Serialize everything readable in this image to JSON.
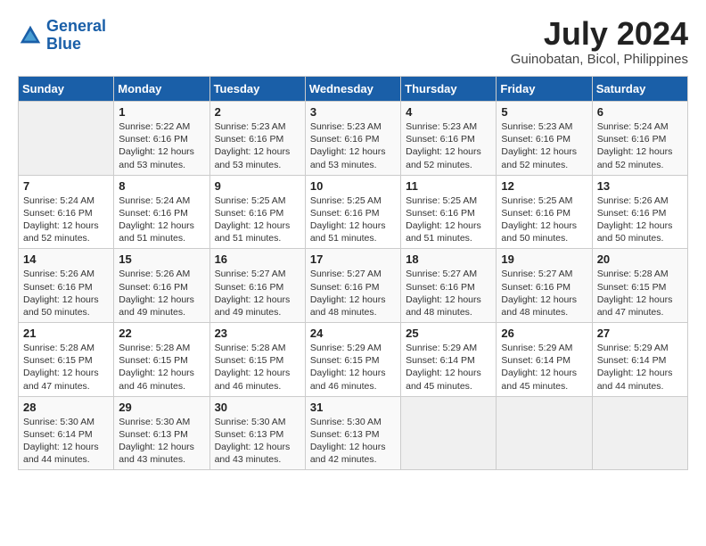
{
  "header": {
    "logo_line1": "General",
    "logo_line2": "Blue",
    "month_year": "July 2024",
    "location": "Guinobatan, Bicol, Philippines"
  },
  "days_of_week": [
    "Sunday",
    "Monday",
    "Tuesday",
    "Wednesday",
    "Thursday",
    "Friday",
    "Saturday"
  ],
  "weeks": [
    [
      {
        "day": "",
        "sunrise": "",
        "sunset": "",
        "daylight": ""
      },
      {
        "day": "1",
        "sunrise": "Sunrise: 5:22 AM",
        "sunset": "Sunset: 6:16 PM",
        "daylight": "Daylight: 12 hours and 53 minutes."
      },
      {
        "day": "2",
        "sunrise": "Sunrise: 5:23 AM",
        "sunset": "Sunset: 6:16 PM",
        "daylight": "Daylight: 12 hours and 53 minutes."
      },
      {
        "day": "3",
        "sunrise": "Sunrise: 5:23 AM",
        "sunset": "Sunset: 6:16 PM",
        "daylight": "Daylight: 12 hours and 53 minutes."
      },
      {
        "day": "4",
        "sunrise": "Sunrise: 5:23 AM",
        "sunset": "Sunset: 6:16 PM",
        "daylight": "Daylight: 12 hours and 52 minutes."
      },
      {
        "day": "5",
        "sunrise": "Sunrise: 5:23 AM",
        "sunset": "Sunset: 6:16 PM",
        "daylight": "Daylight: 12 hours and 52 minutes."
      },
      {
        "day": "6",
        "sunrise": "Sunrise: 5:24 AM",
        "sunset": "Sunset: 6:16 PM",
        "daylight": "Daylight: 12 hours and 52 minutes."
      }
    ],
    [
      {
        "day": "7",
        "sunrise": "Sunrise: 5:24 AM",
        "sunset": "Sunset: 6:16 PM",
        "daylight": "Daylight: 12 hours and 52 minutes."
      },
      {
        "day": "8",
        "sunrise": "Sunrise: 5:24 AM",
        "sunset": "Sunset: 6:16 PM",
        "daylight": "Daylight: 12 hours and 51 minutes."
      },
      {
        "day": "9",
        "sunrise": "Sunrise: 5:25 AM",
        "sunset": "Sunset: 6:16 PM",
        "daylight": "Daylight: 12 hours and 51 minutes."
      },
      {
        "day": "10",
        "sunrise": "Sunrise: 5:25 AM",
        "sunset": "Sunset: 6:16 PM",
        "daylight": "Daylight: 12 hours and 51 minutes."
      },
      {
        "day": "11",
        "sunrise": "Sunrise: 5:25 AM",
        "sunset": "Sunset: 6:16 PM",
        "daylight": "Daylight: 12 hours and 51 minutes."
      },
      {
        "day": "12",
        "sunrise": "Sunrise: 5:25 AM",
        "sunset": "Sunset: 6:16 PM",
        "daylight": "Daylight: 12 hours and 50 minutes."
      },
      {
        "day": "13",
        "sunrise": "Sunrise: 5:26 AM",
        "sunset": "Sunset: 6:16 PM",
        "daylight": "Daylight: 12 hours and 50 minutes."
      }
    ],
    [
      {
        "day": "14",
        "sunrise": "Sunrise: 5:26 AM",
        "sunset": "Sunset: 6:16 PM",
        "daylight": "Daylight: 12 hours and 50 minutes."
      },
      {
        "day": "15",
        "sunrise": "Sunrise: 5:26 AM",
        "sunset": "Sunset: 6:16 PM",
        "daylight": "Daylight: 12 hours and 49 minutes."
      },
      {
        "day": "16",
        "sunrise": "Sunrise: 5:27 AM",
        "sunset": "Sunset: 6:16 PM",
        "daylight": "Daylight: 12 hours and 49 minutes."
      },
      {
        "day": "17",
        "sunrise": "Sunrise: 5:27 AM",
        "sunset": "Sunset: 6:16 PM",
        "daylight": "Daylight: 12 hours and 48 minutes."
      },
      {
        "day": "18",
        "sunrise": "Sunrise: 5:27 AM",
        "sunset": "Sunset: 6:16 PM",
        "daylight": "Daylight: 12 hours and 48 minutes."
      },
      {
        "day": "19",
        "sunrise": "Sunrise: 5:27 AM",
        "sunset": "Sunset: 6:16 PM",
        "daylight": "Daylight: 12 hours and 48 minutes."
      },
      {
        "day": "20",
        "sunrise": "Sunrise: 5:28 AM",
        "sunset": "Sunset: 6:15 PM",
        "daylight": "Daylight: 12 hours and 47 minutes."
      }
    ],
    [
      {
        "day": "21",
        "sunrise": "Sunrise: 5:28 AM",
        "sunset": "Sunset: 6:15 PM",
        "daylight": "Daylight: 12 hours and 47 minutes."
      },
      {
        "day": "22",
        "sunrise": "Sunrise: 5:28 AM",
        "sunset": "Sunset: 6:15 PM",
        "daylight": "Daylight: 12 hours and 46 minutes."
      },
      {
        "day": "23",
        "sunrise": "Sunrise: 5:28 AM",
        "sunset": "Sunset: 6:15 PM",
        "daylight": "Daylight: 12 hours and 46 minutes."
      },
      {
        "day": "24",
        "sunrise": "Sunrise: 5:29 AM",
        "sunset": "Sunset: 6:15 PM",
        "daylight": "Daylight: 12 hours and 46 minutes."
      },
      {
        "day": "25",
        "sunrise": "Sunrise: 5:29 AM",
        "sunset": "Sunset: 6:14 PM",
        "daylight": "Daylight: 12 hours and 45 minutes."
      },
      {
        "day": "26",
        "sunrise": "Sunrise: 5:29 AM",
        "sunset": "Sunset: 6:14 PM",
        "daylight": "Daylight: 12 hours and 45 minutes."
      },
      {
        "day": "27",
        "sunrise": "Sunrise: 5:29 AM",
        "sunset": "Sunset: 6:14 PM",
        "daylight": "Daylight: 12 hours and 44 minutes."
      }
    ],
    [
      {
        "day": "28",
        "sunrise": "Sunrise: 5:30 AM",
        "sunset": "Sunset: 6:14 PM",
        "daylight": "Daylight: 12 hours and 44 minutes."
      },
      {
        "day": "29",
        "sunrise": "Sunrise: 5:30 AM",
        "sunset": "Sunset: 6:13 PM",
        "daylight": "Daylight: 12 hours and 43 minutes."
      },
      {
        "day": "30",
        "sunrise": "Sunrise: 5:30 AM",
        "sunset": "Sunset: 6:13 PM",
        "daylight": "Daylight: 12 hours and 43 minutes."
      },
      {
        "day": "31",
        "sunrise": "Sunrise: 5:30 AM",
        "sunset": "Sunset: 6:13 PM",
        "daylight": "Daylight: 12 hours and 42 minutes."
      },
      {
        "day": "",
        "sunrise": "",
        "sunset": "",
        "daylight": ""
      },
      {
        "day": "",
        "sunrise": "",
        "sunset": "",
        "daylight": ""
      },
      {
        "day": "",
        "sunrise": "",
        "sunset": "",
        "daylight": ""
      }
    ]
  ]
}
